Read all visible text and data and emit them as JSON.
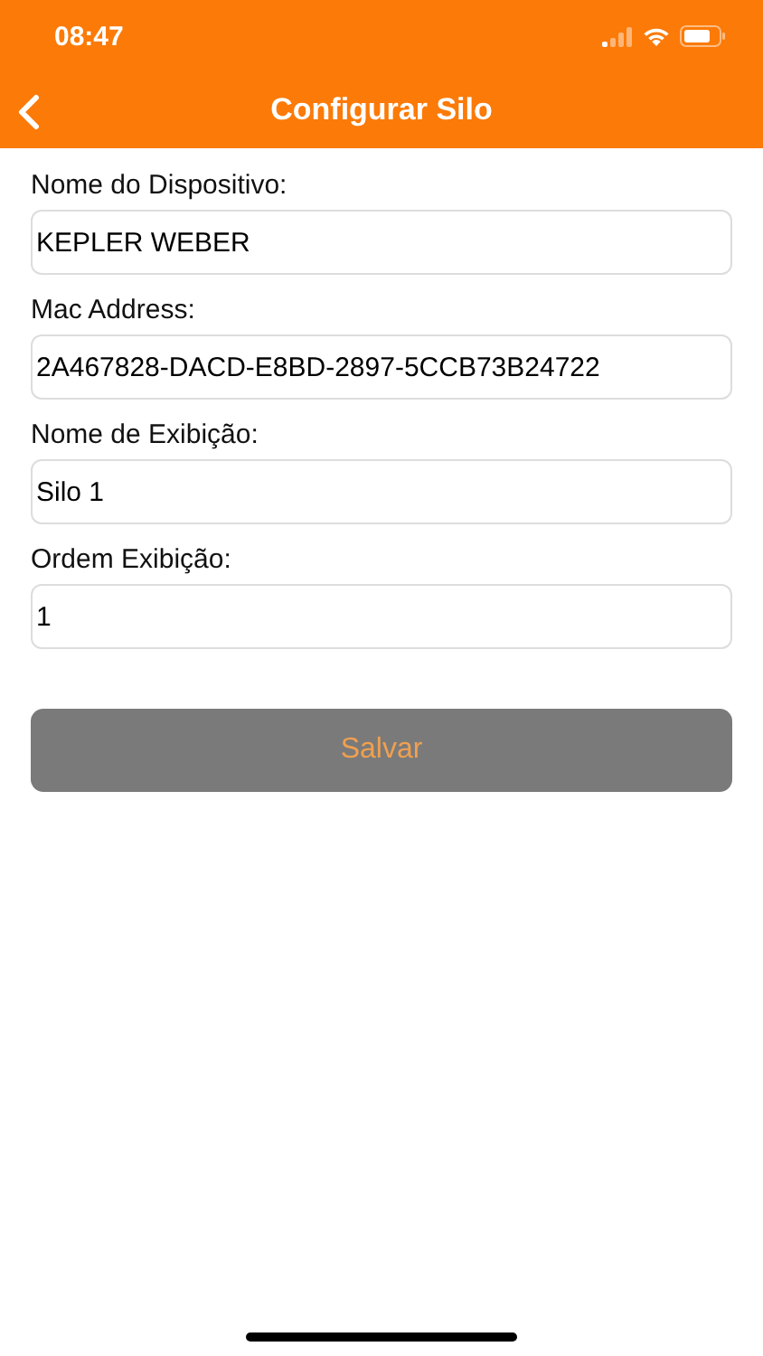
{
  "status_bar": {
    "time": "08:47"
  },
  "nav_bar": {
    "title": "Configurar Silo"
  },
  "fields": [
    {
      "label": "Nome do Dispositivo:",
      "value": "KEPLER WEBER"
    },
    {
      "label": "Mac Address:",
      "value": "2A467828-DACD-E8BD-2897-5CCB73B24722"
    },
    {
      "label": "Nome de Exibição:",
      "value": "Silo 1"
    },
    {
      "label": "Ordem Exibição:",
      "value": "1"
    }
  ],
  "save_button": {
    "label": "Salvar",
    "disabled": true
  }
}
